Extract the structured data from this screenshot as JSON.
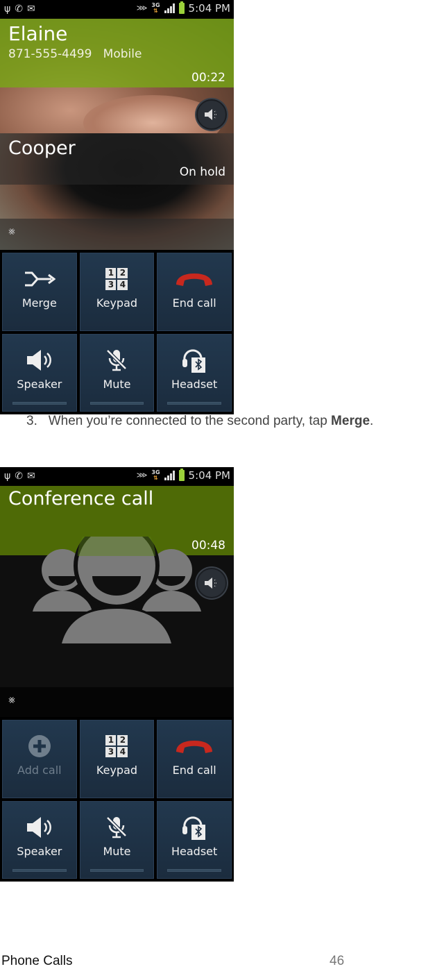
{
  "status_bar": {
    "left_icons": [
      "usb-icon",
      "phone-call-icon",
      "email-icon"
    ],
    "right_icons": [
      "vibrate-mute-icon",
      "3g-data-icon",
      "signal-icon",
      "battery-icon"
    ],
    "network": "3G",
    "time": "5:04 PM"
  },
  "screenshot1": {
    "active_call": {
      "name": "Elaine",
      "number": "871-555-4499",
      "number_type": "Mobile",
      "timer": "00:22"
    },
    "held_call": {
      "name": "Cooper",
      "status": "On hold"
    },
    "buttons": [
      {
        "label": "Merge",
        "icon": "merge-icon",
        "enabled": true
      },
      {
        "label": "Keypad",
        "icon": "keypad-icon",
        "enabled": true
      },
      {
        "label": "End call",
        "icon": "end-call-icon",
        "enabled": true
      },
      {
        "label": "Speaker",
        "icon": "speaker-icon",
        "enabled": true
      },
      {
        "label": "Mute",
        "icon": "mute-icon",
        "enabled": true
      },
      {
        "label": "Headset",
        "icon": "bluetooth-headset-icon",
        "enabled": true
      }
    ]
  },
  "caption": {
    "step": "3.",
    "text": "When you’re connected to the second party, tap ",
    "bold": "Merge",
    "end": "."
  },
  "screenshot2": {
    "title": "Conference call",
    "timer": "00:48",
    "buttons": [
      {
        "label": "Add call",
        "icon": "add-call-icon",
        "enabled": false
      },
      {
        "label": "Keypad",
        "icon": "keypad-icon",
        "enabled": true
      },
      {
        "label": "End call",
        "icon": "end-call-icon",
        "enabled": true
      },
      {
        "label": "Speaker",
        "icon": "speaker-icon",
        "enabled": true
      },
      {
        "label": "Mute",
        "icon": "mute-icon",
        "enabled": true
      },
      {
        "label": "Headset",
        "icon": "bluetooth-headset-icon",
        "enabled": true
      }
    ]
  },
  "keypad_digits": [
    "1",
    "2",
    "3",
    "4"
  ],
  "footer": {
    "section": "Phone Calls",
    "page": "46"
  },
  "colors": {
    "active_call_band": "#78aa14",
    "conference_band": "#4e6a06",
    "button_bg": "#1f3347",
    "end_call_red": "#c8281e",
    "battery_green": "#9bd13a"
  }
}
